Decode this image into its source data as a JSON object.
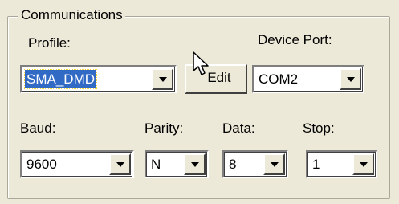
{
  "group": {
    "title": "Communications"
  },
  "profile": {
    "label": "Profile:",
    "value": "SMA_DMD"
  },
  "edit_button": {
    "label": "Edit"
  },
  "device_port": {
    "label": "Device Port:",
    "value": "COM2"
  },
  "baud": {
    "label": "Baud:",
    "value": "9600"
  },
  "parity": {
    "label": "Parity:",
    "value": "N"
  },
  "data_bits": {
    "label": "Data:",
    "value": "8"
  },
  "stop_bits": {
    "label": "Stop:",
    "value": "1"
  },
  "icons": {
    "dropdown": "chevron-down-icon",
    "pointer": "mouse-pointer-icon"
  }
}
